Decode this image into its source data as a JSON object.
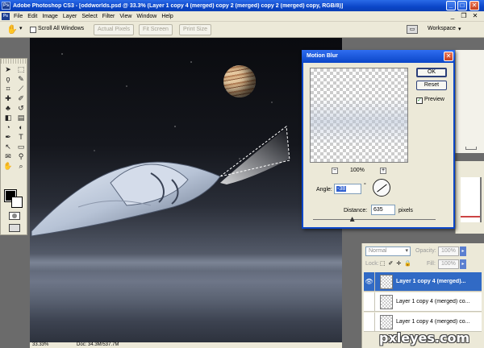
{
  "window": {
    "title": "Adobe Photoshop CS3 - [oddworlds.psd @ 33.3% (Layer 1 copy 4 (merged) copy 2 (merged) copy 2 (merged) copy, RGB/8)]",
    "logo_text": "Ps",
    "min_glyph": "_",
    "max_glyph": "□",
    "close_glyph": "✕"
  },
  "menubar": {
    "app_icon_text": "Ps",
    "items": [
      "File",
      "Edit",
      "Image",
      "Layer",
      "Select",
      "Filter",
      "View",
      "Window",
      "Help"
    ],
    "controls": {
      "min": "_",
      "restore": "❐",
      "close": "✕"
    }
  },
  "options_bar": {
    "tool_icon": "hand-icon",
    "tool_glyph": "✋",
    "caret": "▾",
    "scroll_all_windows": "Scroll All Windows",
    "actual_pixels": "Actual Pixels",
    "fit_screen": "Fit Screen",
    "print_size": "Print Size",
    "workspace": "Workspace",
    "workspace_caret": "▾"
  },
  "toolbox": {
    "tools": [
      {
        "name": "move-tool",
        "glyph": "➤"
      },
      {
        "name": "marquee-tool",
        "glyph": "⬚"
      },
      {
        "name": "lasso-tool",
        "glyph": "ϙ"
      },
      {
        "name": "quick-select-tool",
        "glyph": "✎"
      },
      {
        "name": "crop-tool",
        "glyph": "⌗"
      },
      {
        "name": "slice-tool",
        "glyph": "⟋"
      },
      {
        "name": "healing-tool",
        "glyph": "✚"
      },
      {
        "name": "brush-tool",
        "glyph": "✐"
      },
      {
        "name": "stamp-tool",
        "glyph": "♣"
      },
      {
        "name": "history-brush-tool",
        "glyph": "↺"
      },
      {
        "name": "eraser-tool",
        "glyph": "◧"
      },
      {
        "name": "gradient-tool",
        "glyph": "▤"
      },
      {
        "name": "blur-tool",
        "glyph": "◔"
      },
      {
        "name": "dodge-tool",
        "glyph": "◐"
      },
      {
        "name": "pen-tool",
        "glyph": "✒"
      },
      {
        "name": "type-tool",
        "glyph": "T"
      },
      {
        "name": "path-select-tool",
        "glyph": "↖"
      },
      {
        "name": "shape-tool",
        "glyph": "▭"
      },
      {
        "name": "notes-tool",
        "glyph": "✉"
      },
      {
        "name": "eyedropper-tool",
        "glyph": "⚲"
      },
      {
        "name": "hand-tool",
        "glyph": "✋"
      },
      {
        "name": "zoom-tool",
        "glyph": "⌕"
      }
    ],
    "foreground_color": "#000000",
    "background_color": "#ffffff"
  },
  "document": {
    "zoom": "33.33%",
    "doc_info": "Doc: 34.3M/537.7M"
  },
  "motion_blur": {
    "title": "Motion Blur",
    "close_glyph": "✕",
    "ok": "OK",
    "reset": "Reset",
    "preview_label": "Preview",
    "preview_checked": "✓",
    "zoom_minus": "−",
    "zoom_plus": "+",
    "zoom_value": "100%",
    "angle_label": "Angle:",
    "angle_value": "-38",
    "degree_symbol": "°",
    "distance_label": "Distance:",
    "distance_value": "635",
    "distance_unit": "pixels",
    "distance_fraction": 0.32
  },
  "layers_panel": {
    "blend_mode": "Normal",
    "opacity_label": "Opacity:",
    "opacity_value": "100%",
    "lock_label": "Lock:",
    "lock_icons": "⬚ ✐ ✛ 🔒",
    "fill_label": "Fill:",
    "fill_value": "100%",
    "spin_caret": "▸",
    "eye_glyph": "👁",
    "rows": [
      {
        "name": "Layer 1 copy 4 (merged)...",
        "selected": true,
        "visible": true
      },
      {
        "name": "Layer 1 copy 4 (merged) co...",
        "selected": false,
        "visible": false
      },
      {
        "name": "Layer 1 copy 4 (merged) co...",
        "selected": false,
        "visible": false
      }
    ]
  },
  "watermark": "pxleyes.com",
  "colors": {
    "titlebar": "#0b46c8",
    "selection": "#316ac5",
    "panel_bg": "#ece9d8"
  }
}
